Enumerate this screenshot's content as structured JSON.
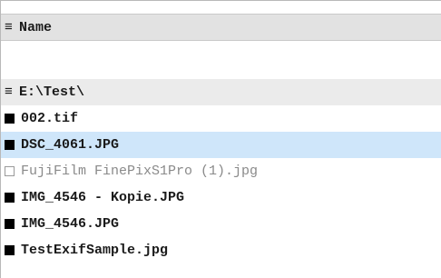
{
  "header": {
    "menu_glyph": "≡",
    "column_label": "Name"
  },
  "group": {
    "glyph": "≡",
    "label": "E:\\Test\\"
  },
  "files": [
    {
      "name": "002.tif",
      "marker": "filled",
      "selected": false,
      "dimmed": false
    },
    {
      "name": "DSC_4061.JPG",
      "marker": "filled",
      "selected": true,
      "dimmed": false
    },
    {
      "name": "FujiFilm FinePixS1Pro (1).jpg",
      "marker": "empty",
      "selected": false,
      "dimmed": true
    },
    {
      "name": "IMG_4546 - Kopie.JPG",
      "marker": "filled",
      "selected": false,
      "dimmed": false
    },
    {
      "name": "IMG_4546.JPG",
      "marker": "filled",
      "selected": false,
      "dimmed": false
    },
    {
      "name": "TestExifSample.jpg",
      "marker": "filled",
      "selected": false,
      "dimmed": false
    }
  ],
  "colors": {
    "selection": "#cfe6fa",
    "header_bg": "#e2e2e2",
    "group_bg": "#ebebeb"
  }
}
